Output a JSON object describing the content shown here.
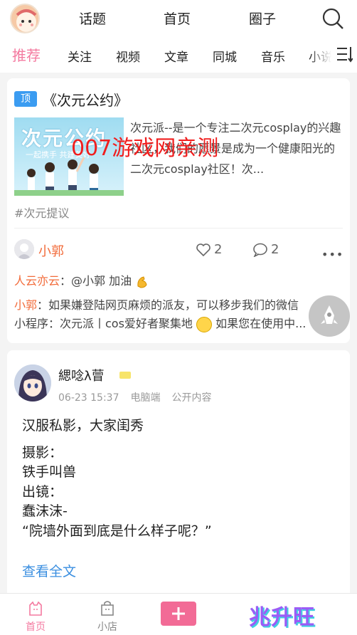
{
  "header": {
    "tabs": [
      "话题",
      "首页",
      "圈子"
    ]
  },
  "categories": [
    "推荐",
    "关注",
    "视频",
    "文章",
    "同城",
    "音乐",
    "小说"
  ],
  "card1": {
    "tag": "顶",
    "title": "《次元公约》",
    "thumb_title": "次元公约",
    "thumb_sub": "一起携手 共建美好",
    "description": "次元派--是一个专注二次元cosplay的兴趣社区，我们的愿景是成为一个健康阳光的二次元cosplay社区！次...",
    "hashtag": "#次元提议",
    "author": "小郭",
    "likes": "2",
    "comments": "2",
    "replies": [
      {
        "name": "人云亦云",
        "text": "：@小郭 加油"
      },
      {
        "name": "小郭",
        "text": "：如果嫌登陆网页麻烦的派友，可以移步我们的微信"
      },
      {
        "name": "",
        "text": "小程序：次元派丨cos爱好者聚集地",
        "text2": "如果您在使用中..."
      }
    ]
  },
  "watermark": "007游戏网亲测",
  "card2": {
    "author": "緦唸λ萺",
    "date": "06-23 15:37",
    "device": "电脑端",
    "visibility": "公开内容",
    "lines": [
      "汉服私影，大家闺秀",
      "摄影：",
      "铁手叫兽",
      "出镜：",
      "蠢沫沫-",
      "“院墙外面到底是什么样子呢？”"
    ],
    "read_more": "查看全文"
  },
  "bottom_nav": {
    "home": "首页",
    "shop": "小店"
  },
  "logo_text": "兆升旺",
  "colors": {
    "accent": "#f47aa0",
    "username": "#f26b3a",
    "link": "#3b8fe0",
    "pin_tag": "#3b9cf1"
  }
}
